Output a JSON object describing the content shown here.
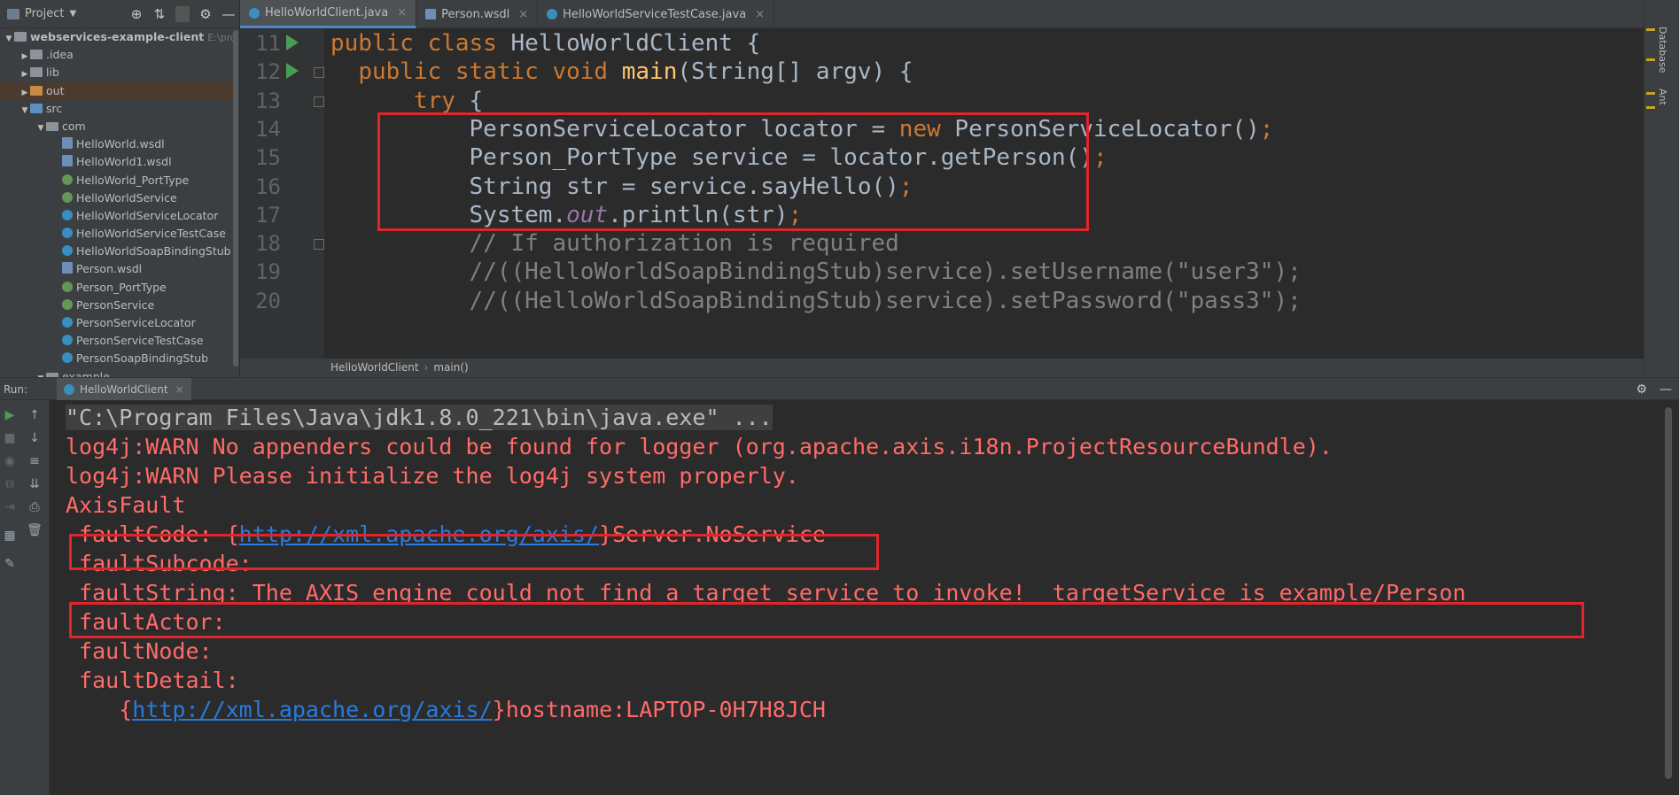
{
  "project_panel": {
    "title": "Project",
    "tree": [
      {
        "label": "webservices-example-client",
        "hint": "E:\\project",
        "depth": 0,
        "arrow": "▼",
        "icon": "proj",
        "bold": true
      },
      {
        "label": ".idea",
        "depth": 1,
        "arrow": "▶",
        "icon": "folder"
      },
      {
        "label": "lib",
        "depth": 1,
        "arrow": "▶",
        "icon": "folder"
      },
      {
        "label": "out",
        "depth": 1,
        "arrow": "▶",
        "icon": "folder-orange",
        "selected": true
      },
      {
        "label": "src",
        "depth": 1,
        "arrow": "▼",
        "icon": "folder-blue"
      },
      {
        "label": "com",
        "depth": 2,
        "arrow": "▼",
        "icon": "pkg"
      },
      {
        "label": "HelloWorld.wsdl",
        "depth": 3,
        "icon": "wsdl"
      },
      {
        "label": "HelloWorld1.wsdl",
        "depth": 3,
        "icon": "wsdl"
      },
      {
        "label": "HelloWorld_PortType",
        "depth": 3,
        "icon": "intf"
      },
      {
        "label": "HelloWorldService",
        "depth": 3,
        "icon": "intf"
      },
      {
        "label": "HelloWorldServiceLocator",
        "depth": 3,
        "icon": "cls"
      },
      {
        "label": "HelloWorldServiceTestCase",
        "depth": 3,
        "icon": "cls"
      },
      {
        "label": "HelloWorldSoapBindingStub",
        "depth": 3,
        "icon": "cls"
      },
      {
        "label": "Person.wsdl",
        "depth": 3,
        "icon": "wsdl"
      },
      {
        "label": "Person_PortType",
        "depth": 3,
        "icon": "intf"
      },
      {
        "label": "PersonService",
        "depth": 3,
        "icon": "intf"
      },
      {
        "label": "PersonServiceLocator",
        "depth": 3,
        "icon": "cls"
      },
      {
        "label": "PersonServiceTestCase",
        "depth": 3,
        "icon": "cls"
      },
      {
        "label": "PersonSoapBindingStub",
        "depth": 3,
        "icon": "cls"
      },
      {
        "label": "example",
        "depth": 2,
        "arrow": "▼",
        "icon": "pkg"
      }
    ]
  },
  "tabs": [
    {
      "label": "HelloWorldClient.java",
      "active": true,
      "icon": "class-icon"
    },
    {
      "label": "Person.wsdl",
      "active": false,
      "icon": "wsdl-icon"
    },
    {
      "label": "HelloWorldServiceTestCase.java",
      "active": false,
      "icon": "class-icon"
    }
  ],
  "editor": {
    "lines": [
      {
        "num": "11",
        "run": true,
        "fold": false,
        "html": "<span class=\"kw\">public class </span>HelloWorldClient {"
      },
      {
        "num": "12",
        "run": true,
        "fold": true,
        "html": "  <span class=\"kw\">public static void </span><span class=\"fn\">main</span>(String[] argv) {"
      },
      {
        "num": "13",
        "run": false,
        "fold": true,
        "html": "      <span class=\"kw\">try </span>{"
      },
      {
        "num": "14",
        "run": false,
        "fold": false,
        "html": "          PersonServiceLocator locator = <span class=\"kw\">new </span>PersonServiceLocator()<span class=\"kw\">;</span>"
      },
      {
        "num": "15",
        "run": false,
        "fold": false,
        "html": "          Person_PortType service = locator.getPerson()<span class=\"kw\">;</span>"
      },
      {
        "num": "16",
        "run": false,
        "fold": false,
        "html": "          String str = service.sayHello()<span class=\"kw\">;</span>"
      },
      {
        "num": "17",
        "run": false,
        "fold": false,
        "html": "          System.<span class=\"it\">out</span>.println(str)<span class=\"kw\">;</span>"
      },
      {
        "num": "18",
        "run": false,
        "fold": true,
        "html": "          <span class=\"cm\">// If authorization is required</span>"
      },
      {
        "num": "19",
        "run": false,
        "fold": false,
        "html": "          <span class=\"cm\">//((HelloWorldSoapBindingStub)service).setUsername(\"user3\");</span>"
      },
      {
        "num": "20",
        "run": false,
        "fold": false,
        "html": "          <span class=\"cm\">//((HelloWorldSoapBindingStub)service).setPassword(\"pass3\");</span>"
      }
    ]
  },
  "breadcrumb": {
    "class_name": "HelloWorldClient",
    "method": "main()"
  },
  "right_strip": {
    "database_label": "Database",
    "ant_label": "Ant"
  },
  "run_panel": {
    "label": "Run:",
    "tab_label": "HelloWorldClient",
    "console": {
      "command": "\"C:\\Program Files\\Java\\jdk1.8.0_221\\bin\\java.exe\" ...",
      "warn1": "log4j:WARN No appenders could be found for logger (org.apache.axis.i18n.ProjectResourceBundle).",
      "warn2": "log4j:WARN Please initialize the log4j system properly.",
      "axis_fault": "AxisFault",
      "fault_code_prefix": " faultCode: {",
      "fault_code_link": "http://xml.apache.org/axis/",
      "fault_code_suffix": "}Server.NoService",
      "fault_subcode": " faultSubcode:",
      "fault_string": " faultString: The AXIS engine could not find a target service to invoke!  targetService is example/Person",
      "fault_actor": " faultActor:",
      "fault_node": " faultNode:",
      "fault_detail": " faultDetail:",
      "detail_prefix": "    {",
      "detail_link": "http://xml.apache.org/axis/",
      "detail_suffix": "}hostname:LAPTOP-0H7H8JCH"
    }
  },
  "colors": {
    "highlight_box": "#e0252b",
    "error_text": "#ff6b68",
    "link": "#287bde",
    "keyword": "#cc7832"
  }
}
